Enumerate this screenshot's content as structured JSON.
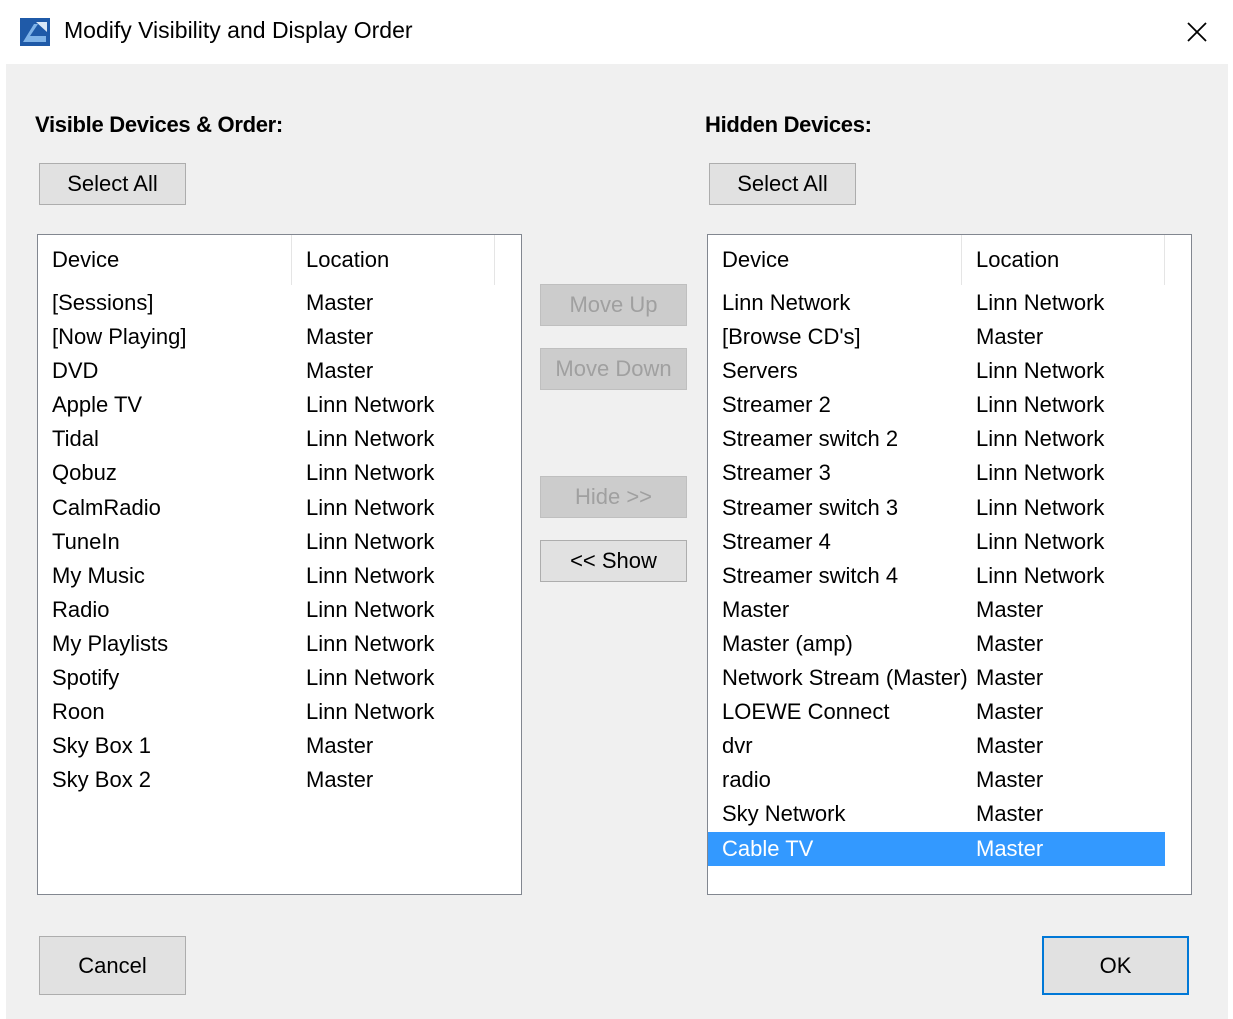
{
  "window": {
    "title": "Modify Visibility and Display Order",
    "icon": "app-logo-icon",
    "close_icon": "close-icon"
  },
  "visible_panel": {
    "heading": "Visible Devices & Order:",
    "select_all_label": "Select All",
    "columns": [
      "Device",
      "Location"
    ],
    "rows": [
      {
        "device": "[Sessions]",
        "location": "Master"
      },
      {
        "device": "[Now Playing]",
        "location": "Master"
      },
      {
        "device": "DVD",
        "location": "Master"
      },
      {
        "device": "Apple TV",
        "location": "Linn Network"
      },
      {
        "device": "Tidal",
        "location": "Linn Network"
      },
      {
        "device": "Qobuz",
        "location": "Linn Network"
      },
      {
        "device": "CalmRadio",
        "location": "Linn Network"
      },
      {
        "device": "TuneIn",
        "location": "Linn Network"
      },
      {
        "device": "My Music",
        "location": "Linn Network"
      },
      {
        "device": "Radio",
        "location": "Linn Network"
      },
      {
        "device": "My Playlists",
        "location": "Linn Network"
      },
      {
        "device": "Spotify",
        "location": "Linn Network"
      },
      {
        "device": "Roon",
        "location": "Linn Network"
      },
      {
        "device": "Sky Box 1",
        "location": "Master"
      },
      {
        "device": "Sky Box 2",
        "location": "Master"
      }
    ]
  },
  "hidden_panel": {
    "heading": "Hidden Devices:",
    "select_all_label": "Select All",
    "columns": [
      "Device",
      "Location"
    ],
    "rows": [
      {
        "device": "Linn Network",
        "location": "Linn Network"
      },
      {
        "device": "[Browse CD's]",
        "location": "Master"
      },
      {
        "device": "Servers",
        "location": "Linn Network"
      },
      {
        "device": "Streamer 2",
        "location": "Linn Network"
      },
      {
        "device": "Streamer switch 2",
        "location": "Linn Network"
      },
      {
        "device": "Streamer 3",
        "location": "Linn Network"
      },
      {
        "device": "Streamer switch 3",
        "location": "Linn Network"
      },
      {
        "device": "Streamer 4",
        "location": "Linn Network"
      },
      {
        "device": "Streamer switch 4",
        "location": "Linn Network"
      },
      {
        "device": "Master",
        "location": "Master"
      },
      {
        "device": "Master (amp)",
        "location": "Master"
      },
      {
        "device": "Network Stream (Master)",
        "location": "Master"
      },
      {
        "device": "LOEWE Connect",
        "location": "Master"
      },
      {
        "device": "dvr",
        "location": "Master"
      },
      {
        "device": "radio",
        "location": "Master"
      },
      {
        "device": "Sky Network",
        "location": "Master"
      },
      {
        "device": "Cable TV",
        "location": "Master",
        "selected": true
      }
    ]
  },
  "middle_buttons": {
    "move_up": "Move Up",
    "move_down": "Move Down",
    "hide": "Hide >>",
    "show": "<< Show"
  },
  "footer": {
    "cancel": "Cancel",
    "ok": "OK"
  },
  "colors": {
    "selection": "#3399ff",
    "dialog_background": "#f0f0f0",
    "default_button_border": "#0078d7"
  }
}
